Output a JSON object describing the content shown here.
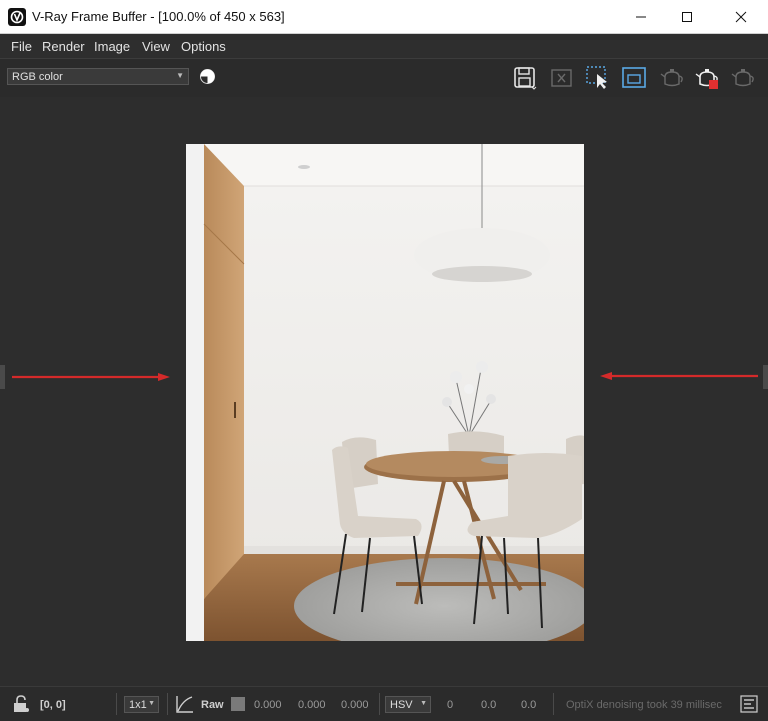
{
  "window": {
    "title": "V-Ray Frame Buffer - [100.0% of 450 x 563]"
  },
  "menu": [
    "File",
    "Render",
    "Image",
    "View",
    "Options"
  ],
  "toolbar": {
    "channel_select": "RGB color",
    "icons": [
      "save-icon",
      "clear-image-icon",
      "region-render-icon",
      "render-region-frame-icon",
      "render-last-icon",
      "render-stop-icon",
      "render-interactive-icon"
    ]
  },
  "statusbar": {
    "coords": "[0, 0]",
    "sample_size": "1x1",
    "raw_label": "Raw",
    "rgb_values": [
      "0.000",
      "0.000",
      "0.000"
    ],
    "color_space": "HSV",
    "hsv_values": [
      "0",
      "0.0",
      "0.0"
    ],
    "message": "OptiX denoising took 39 millisec"
  },
  "colors": {
    "background": "#2b2b2b",
    "titlebar": "#ffffff",
    "accent_red": "#e03030",
    "accent_blue": "#5aa9e6"
  }
}
